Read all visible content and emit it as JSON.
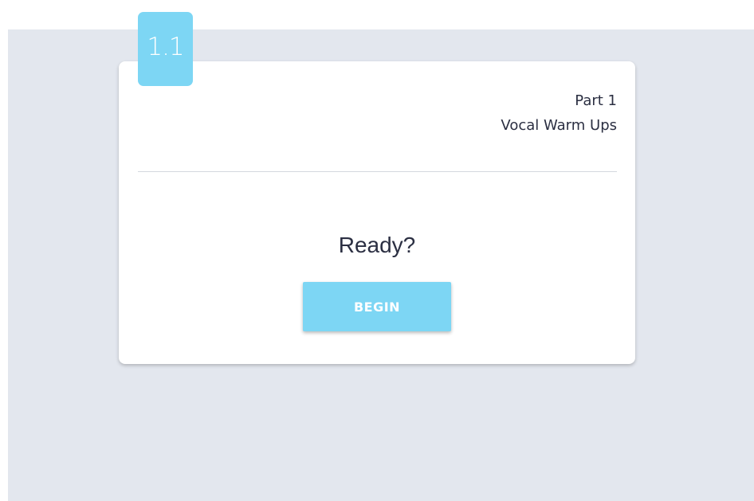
{
  "badge": {
    "label": "1.1"
  },
  "header": {
    "part_label": "Part 1",
    "section_title": "Vocal Warm Ups"
  },
  "main": {
    "prompt": "Ready?",
    "begin_label": "BEGIN"
  },
  "colors": {
    "accent": "#7dd6f4",
    "background": "#e3e7ee",
    "text": "#2b2f42"
  }
}
